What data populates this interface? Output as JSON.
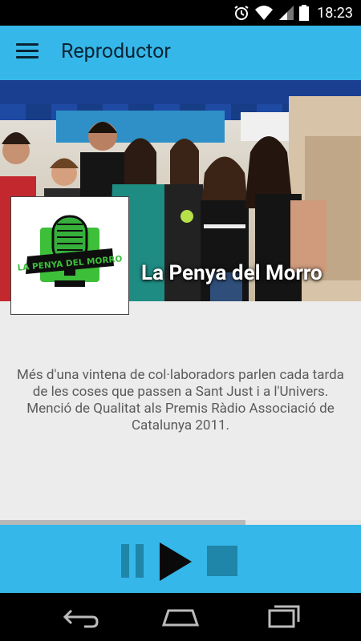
{
  "status_bar": {
    "time": "18:23"
  },
  "app_bar": {
    "title": "Reproductor"
  },
  "program": {
    "title": "La Penya del Morro",
    "logo_text": "LA PENYA DEL MORRO",
    "description": "Més d'una vintena de col·laboradors parlen cada tarda de les coses que passen a Sant Just i a l'Univers. Menció de Qualitat als Premis Ràdio Associació de Catalunya 2011."
  },
  "player": {
    "progress_fraction": 0.68
  },
  "colors": {
    "accent": "#36b7e9",
    "control": "#1f85a9",
    "logo_green": "#3dbf3a"
  }
}
